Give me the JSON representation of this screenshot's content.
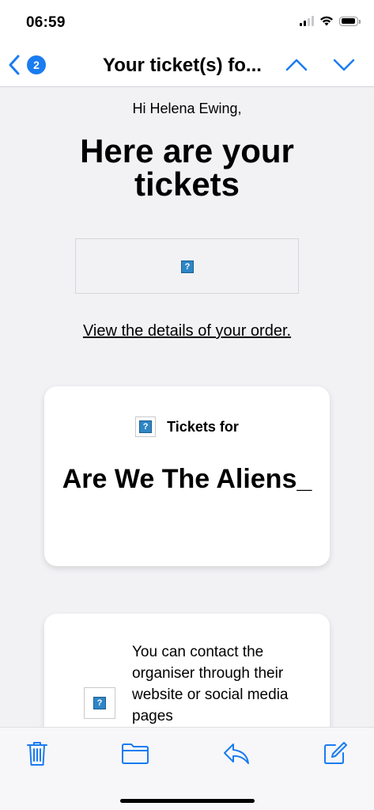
{
  "status_bar": {
    "time": "06:59"
  },
  "nav": {
    "back_badge": "2",
    "title": "Your ticket(s) fo..."
  },
  "email": {
    "greeting": "Hi Helena Ewing,",
    "headline": "Here are your tickets",
    "order_link": "View the details of your order.",
    "tickets_card": {
      "label": "Tickets for",
      "event_name": "Are We The Aliens_"
    },
    "contact_card": {
      "text": "You can contact the organiser through their website or social media pages"
    },
    "broken_image_glyph": "?"
  },
  "toolbar": {
    "icons": [
      "trash-icon",
      "folder-icon",
      "reply-icon",
      "compose-icon"
    ]
  },
  "colors": {
    "accent": "#1a7cf0",
    "background": "#f2f2f5",
    "card": "#ffffff"
  }
}
